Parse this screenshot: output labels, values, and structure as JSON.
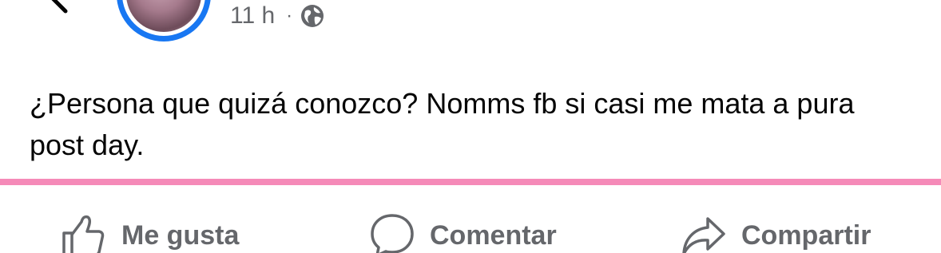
{
  "post": {
    "time": "11 h",
    "separator": "·",
    "privacy_icon": "globe-icon",
    "text": "¿Persona que quizá conozco? Nomms fb si casi me mata a pura post day."
  },
  "actions": {
    "like_label": "Me gusta",
    "comment_label": "Comentar",
    "share_label": "Compartir"
  },
  "colors": {
    "avatar_ring": "#1877f2",
    "separator": "#f58ab8",
    "secondary_text": "#65676b",
    "primary_text": "#050505"
  }
}
